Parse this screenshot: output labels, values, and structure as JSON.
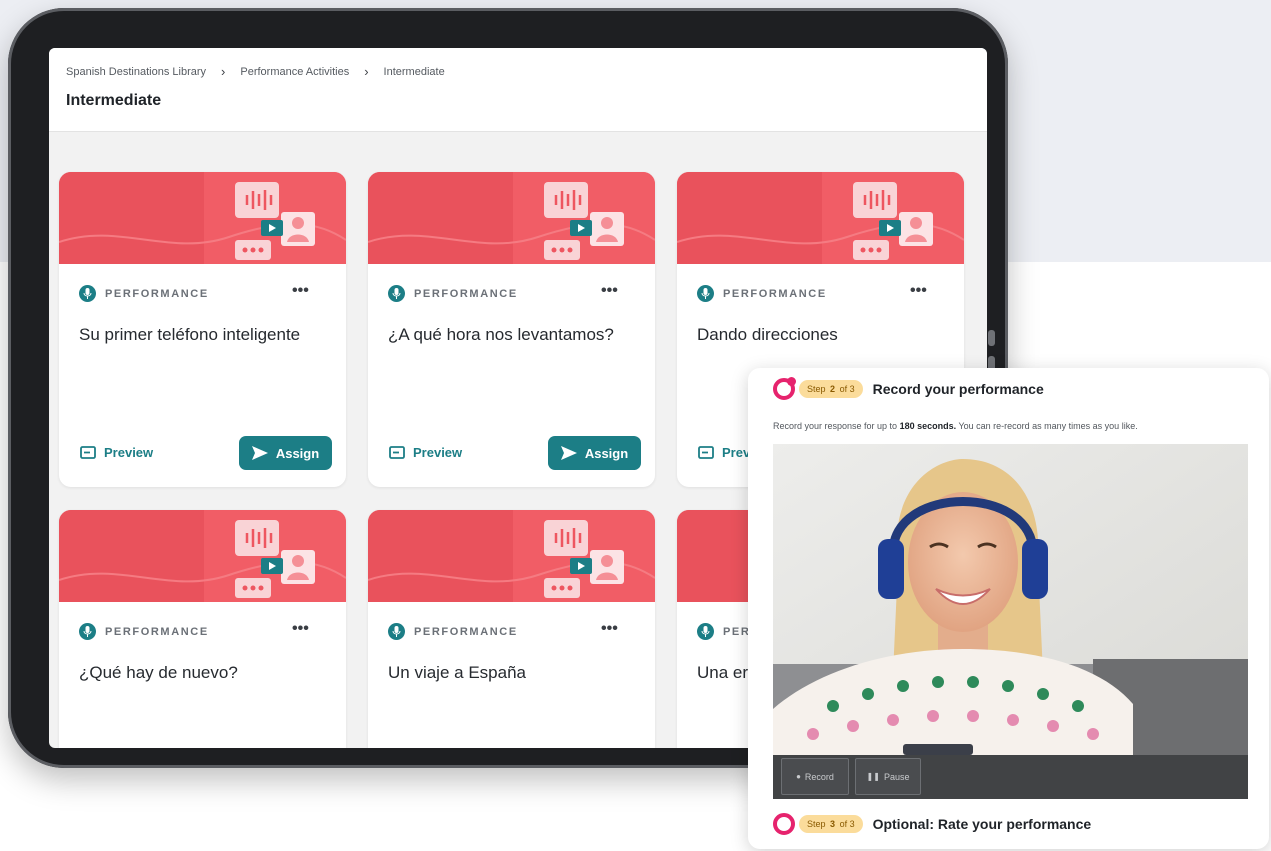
{
  "breadcrumb": {
    "items": [
      "Spanish Destinations Library",
      "Performance Activities",
      "Intermediate"
    ],
    "separator": ">"
  },
  "page_title": "Intermediate",
  "cards": [
    {
      "type": "PERFORMANCE",
      "title": "Su primer teléfono inteligente",
      "preview_label": "Preview",
      "assign_label": "Assign",
      "menu": "•••"
    },
    {
      "type": "PERFORMANCE",
      "title": "¿A qué hora nos levantamos?",
      "preview_label": "Preview",
      "assign_label": "Assign",
      "menu": "•••"
    },
    {
      "type": "PERFORMANCE",
      "title": "Dando direcciones",
      "preview_label": "Prev",
      "assign_label": "",
      "menu": "•••"
    },
    {
      "type": "PERFORMANCE",
      "title": "¿Qué hay de nuevo?",
      "preview_label": "",
      "assign_label": "",
      "menu": "•••"
    },
    {
      "type": "PERFORMANCE",
      "title": "Un viaje a España",
      "preview_label": "",
      "assign_label": "",
      "menu": "•••"
    },
    {
      "type": "PER",
      "title": "Una er",
      "preview_label": "",
      "assign_label": "",
      "menu": ""
    }
  ],
  "recording": {
    "step2": {
      "step_word": "Step",
      "num": "2",
      "of_total": "of 3",
      "heading": "Record your performance"
    },
    "instructions": {
      "before": "Record your response for up to ",
      "bold": "180 seconds.",
      "after": " You can re-record as many times as you like."
    },
    "record_label": "Record",
    "pause_label": "Pause",
    "step3": {
      "step_word": "Step",
      "num": "3",
      "of_total": "of 3",
      "heading": "Optional: Rate your performance"
    }
  },
  "colors": {
    "teal": "#1c7e86",
    "banner_red": "#ee5660",
    "step_pink": "#e6236d",
    "step_pill": "#fbdc9b"
  },
  "icons": {
    "breadcrumb_separator": "chevron-right-icon",
    "badge": "microphone-icon",
    "menu": "kebab-menu-icon",
    "preview": "preview-icon",
    "assign": "send-icon",
    "record": "record-dot-icon",
    "pause": "pause-icon"
  }
}
